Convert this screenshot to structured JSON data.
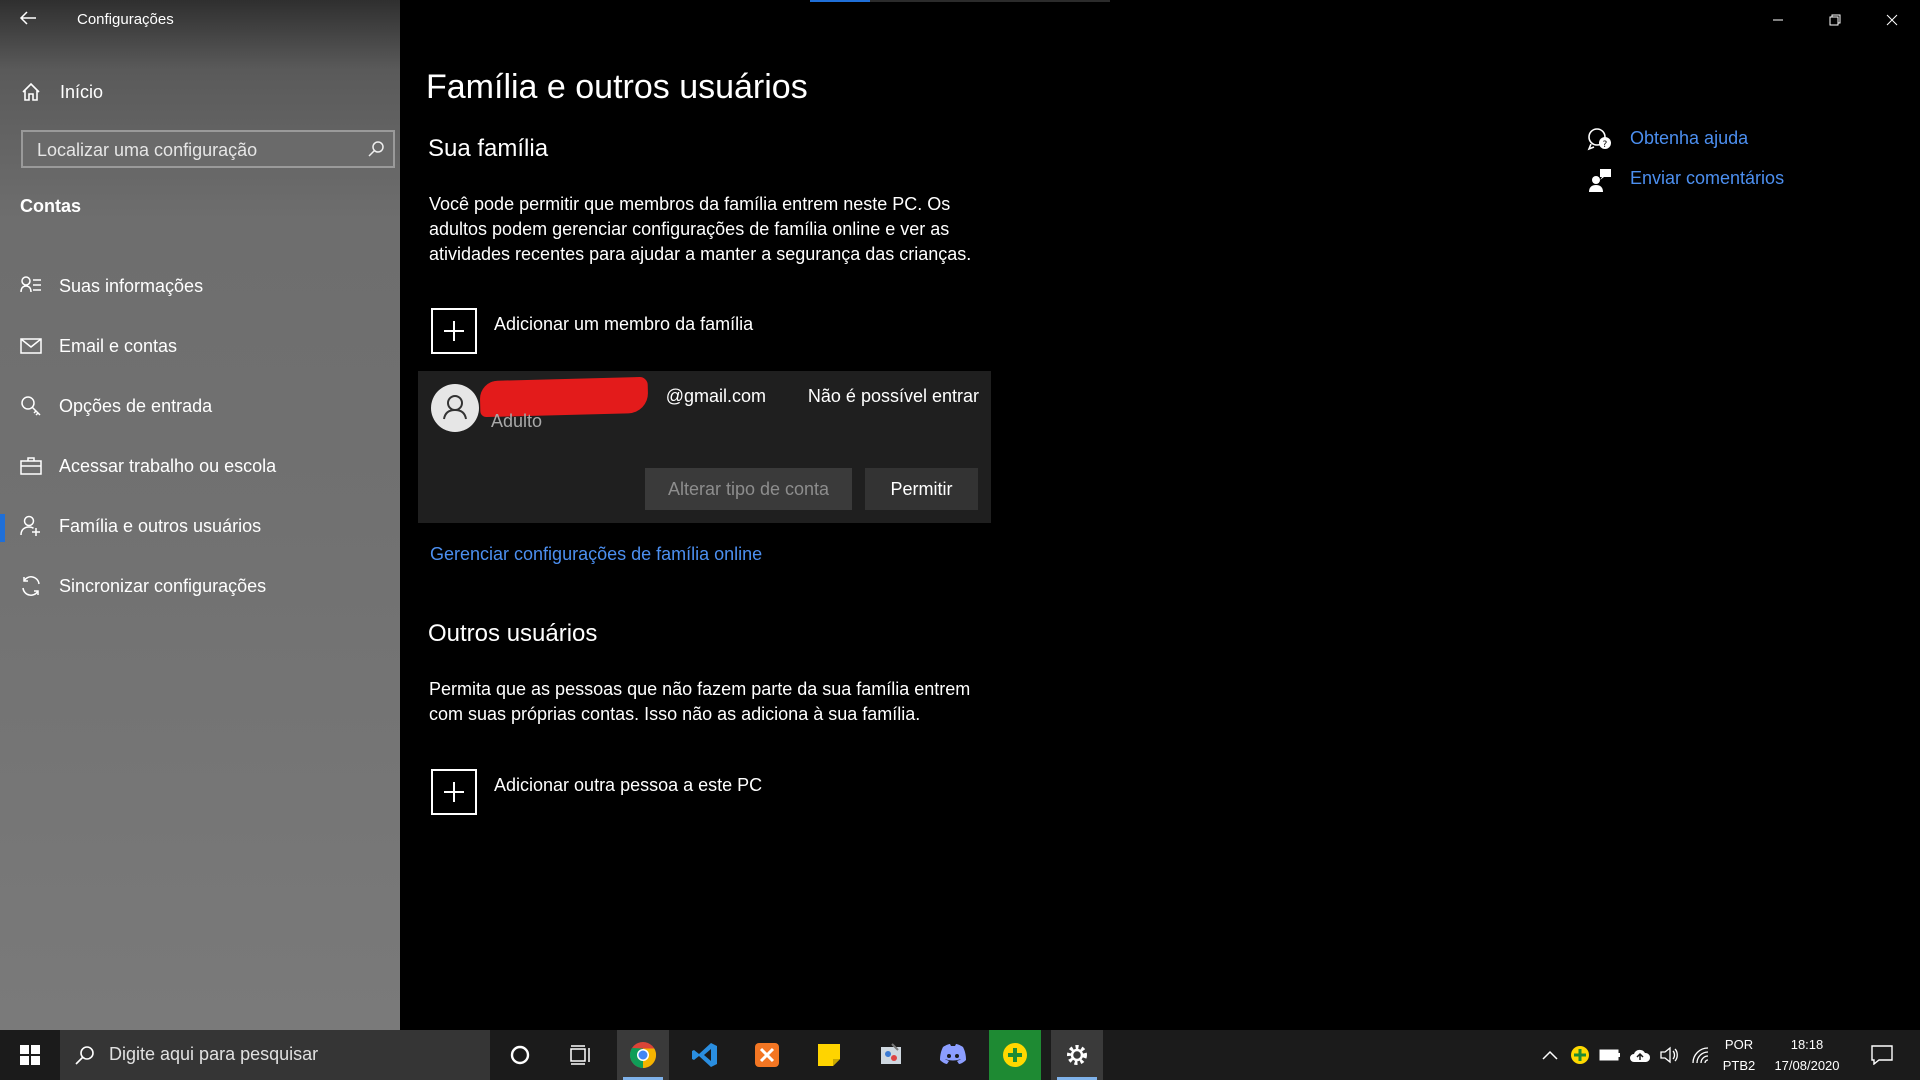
{
  "window": {
    "title": "Configurações"
  },
  "sidebar": {
    "home_label": "Início",
    "search_placeholder": "Localizar uma configuração",
    "section_label": "Contas",
    "items": [
      {
        "label": "Suas informações",
        "icon": "user-info-icon"
      },
      {
        "label": "Email e contas",
        "icon": "mail-icon"
      },
      {
        "label": "Opções de entrada",
        "icon": "key-icon"
      },
      {
        "label": "Acessar trabalho ou escola",
        "icon": "briefcase-icon"
      },
      {
        "label": "Família e outros usuários",
        "icon": "person-add-icon",
        "active": true
      },
      {
        "label": "Sincronizar configurações",
        "icon": "sync-icon"
      }
    ]
  },
  "main": {
    "title": "Família e outros usuários",
    "family": {
      "heading": "Sua família",
      "description": "Você pode permitir que membros da família entrem neste PC. Os adultos podem gerenciar configurações de família online e ver as atividades recentes para ajudar a manter a segurança das crianças.",
      "add_label": "Adicionar um membro da família",
      "member": {
        "email": "@gmail.com",
        "type": "Adulto",
        "status": "Não é possível entrar",
        "change_type_label": "Alterar tipo de conta",
        "allow_label": "Permitir"
      },
      "manage_link": "Gerenciar configurações de família online"
    },
    "others": {
      "heading": "Outros usuários",
      "description": "Permita que as pessoas que não fazem parte da sua família entrem com suas próprias contas. Isso não as adiciona à sua família.",
      "add_label": "Adicionar outra pessoa a este PC"
    },
    "help": {
      "get_help": "Obtenha ajuda",
      "feedback": "Enviar comentários"
    }
  },
  "taskbar": {
    "search_placeholder": "Digite aqui para pesquisar",
    "language": "POR",
    "keyboard": "PTB2",
    "time": "18:18",
    "date": "17/08/2020",
    "apps": [
      "cortana-icon",
      "task-view-icon",
      "chrome-icon",
      "vscode-icon",
      "xampp-icon",
      "sticky-notes-icon",
      "paint-icon",
      "discord-icon",
      "green-plus-app-icon",
      "settings-gear-icon"
    ]
  },
  "colors": {
    "accent": "#1f6fd8",
    "link": "#4c8ff0",
    "redaction": "#e31b1b"
  }
}
